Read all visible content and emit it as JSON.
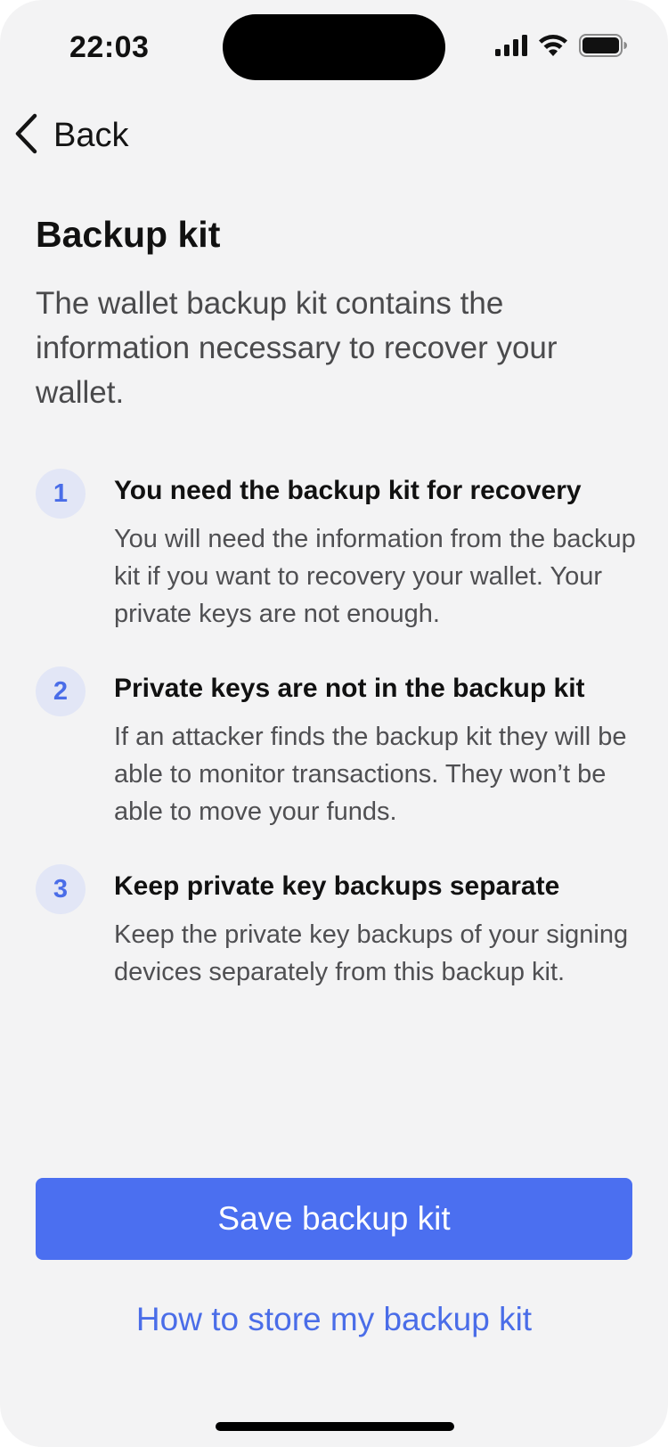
{
  "status_bar": {
    "time": "22:03",
    "icons": [
      "signal-icon",
      "wifi-icon",
      "battery-icon"
    ]
  },
  "nav": {
    "back_label": "Back",
    "back_icon": "chevron-left-icon"
  },
  "page": {
    "title": "Backup kit",
    "intro": "The wallet backup kit contains the information necessary to recover your wallet."
  },
  "steps": [
    {
      "number": "1",
      "title": "You need the backup kit for recovery",
      "body": "You will need the information from the backup kit if you want to recovery your wallet. Your private keys are not enough."
    },
    {
      "number": "2",
      "title": "Private keys are not in the backup kit",
      "body": "If an attacker finds the backup kit they will be able to monitor transactions. They won’t be able to move your funds."
    },
    {
      "number": "3",
      "title": "Keep private key backups separate",
      "body": "Keep the private key backups of your signing devices separately from this backup kit."
    }
  ],
  "actions": {
    "primary_label": "Save backup kit",
    "link_label": "How to store my backup kit"
  },
  "colors": {
    "background": "#f3f3f4",
    "accent": "#4b6ff0",
    "link": "#4a6de8",
    "step_badge_bg": "#e2e6f6",
    "text_primary": "#111111",
    "text_secondary": "#4f4f52"
  }
}
